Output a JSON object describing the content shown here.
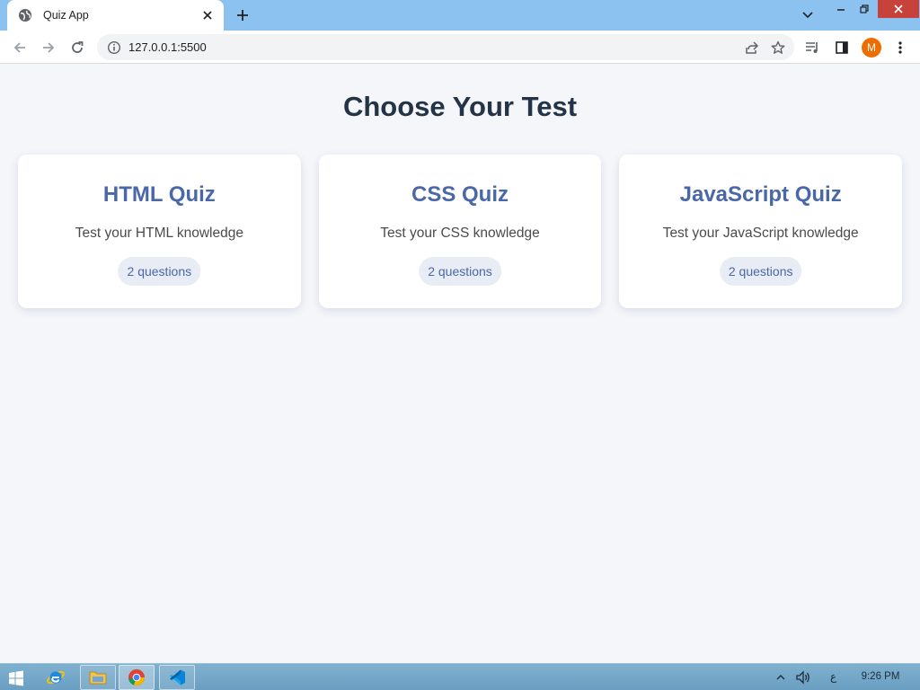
{
  "browser": {
    "tab_title": "Quiz App",
    "url": "127.0.0.1:5500",
    "profile_initial": "M",
    "accent_color": "#8cc2f0",
    "profile_color": "#ef6c00"
  },
  "page": {
    "title": "Choose Your Test",
    "quizzes": [
      {
        "title": "HTML Quiz",
        "description": "Test your HTML knowledge",
        "count": "2 questions"
      },
      {
        "title": "CSS Quiz",
        "description": "Test your CSS knowledge",
        "count": "2 questions"
      },
      {
        "title": "JavaScript Quiz",
        "description": "Test your JavaScript knowledge",
        "count": "2 questions"
      }
    ],
    "title_color": "#4a67a8",
    "background_color": "#f4f6fa"
  },
  "taskbar": {
    "apps": [
      "internet-explorer-icon",
      "file-explorer-icon",
      "chrome-icon",
      "vscode-icon"
    ],
    "language": "ع",
    "time": "9:26 PM"
  }
}
